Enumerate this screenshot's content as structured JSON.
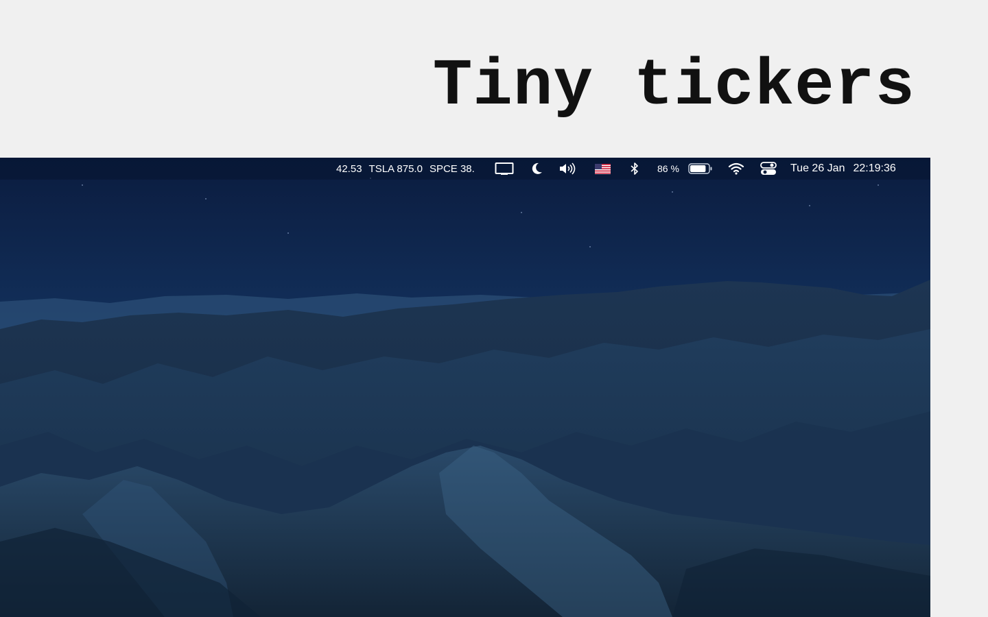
{
  "headline": "Tiny tickers",
  "menubar": {
    "tickers": [
      {
        "text": "42.53"
      },
      {
        "text": "TSLA 875.0"
      },
      {
        "text": "SPCE 38."
      }
    ],
    "icons": [
      "display-mirroring-icon",
      "moon-icon",
      "volume-icon",
      "us-flag-icon",
      "bluetooth-icon",
      "battery-icon",
      "wifi-icon",
      "control-center-icon"
    ],
    "battery_percent_label": "86 %",
    "battery_level": 0.86,
    "date": "Tue 26 Jan",
    "time": "22:19:36"
  },
  "colors": {
    "page_background": "#f0f0f0",
    "headline_text": "#111111",
    "menubar_text": "#ffffff"
  }
}
